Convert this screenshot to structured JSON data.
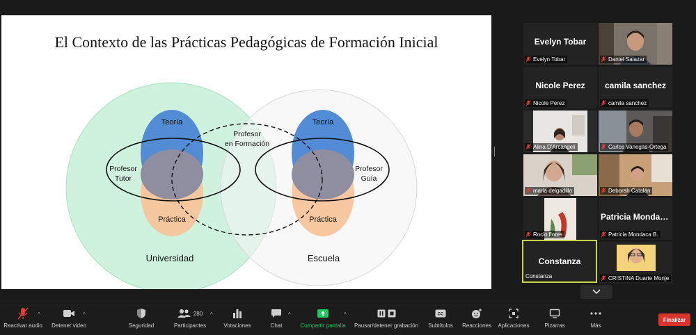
{
  "slide": {
    "title": "El Contexto de las Prácticas Pedagógicas de Formación Inicial",
    "labels": {
      "teoria_left": "Teoría",
      "practica_left": "Práctica",
      "tutor_line1": "Profesor",
      "tutor_line2": "Tutor",
      "formacion_line1": "Profesor",
      "formacion_line2": "en Formación",
      "teoria_right": "Teoría",
      "practica_right": "Práctica",
      "guia_line1": "Profesor",
      "guia_line2": "Guía",
      "universidad": "Universidad",
      "escuela": "Escuela"
    },
    "colors": {
      "universidad_fill": "#c5f0d8",
      "escuela_fill": "#f5f5f5",
      "teoria": "#4a86d4",
      "practica": "#f7c49a",
      "overlap": "#8a8a9e"
    }
  },
  "participants": [
    {
      "name": "Evelyn Tobar",
      "big_name": "Evelyn Tobar",
      "video": false
    },
    {
      "name": "Daniel Salazar",
      "big_name": "",
      "video": true
    },
    {
      "name": "Nicole Perez",
      "big_name": "Nicole Perez",
      "video": false
    },
    {
      "name": "camila sanchez",
      "big_name": "camila sanchez",
      "video": false
    },
    {
      "name": "Alina D'Arcangeli",
      "big_name": "",
      "video": true
    },
    {
      "name": "Carlos Vanegas-Ortega",
      "big_name": "",
      "video": true
    },
    {
      "name": "maria delgadillo",
      "big_name": "",
      "video": true
    },
    {
      "name": "Deborah Catalán",
      "big_name": "",
      "video": true
    },
    {
      "name": "Rocio flores",
      "big_name": "",
      "video": true
    },
    {
      "name": "Patricia Mondaca B.",
      "big_name": "Patricia Mondac...",
      "video": false
    },
    {
      "name": "Constanza",
      "big_name": "Constanza",
      "video": false,
      "active": true
    },
    {
      "name": "CRISTINA Duarte Monje",
      "big_name": "",
      "video": true
    }
  ],
  "toolbar": {
    "audio": "Reactivar audio",
    "video": "Detener video",
    "security": "Seguridad",
    "participants": "Participantes",
    "participants_count": "280",
    "polls": "Votaciones",
    "chat": "Chat",
    "share": "Compartir pantalla",
    "record": "Pausar/detener grabación",
    "captions": "Subtítulos",
    "reactions": "Reacciones",
    "apps": "Aplicaciones",
    "whiteboards": "Pizarras",
    "more": "Más",
    "end": "Finalizar"
  },
  "colors": {
    "accent_green": "#22c55e",
    "active_border": "#c6d84a",
    "muted_red": "#e0403a",
    "end_red": "#d9352c"
  }
}
